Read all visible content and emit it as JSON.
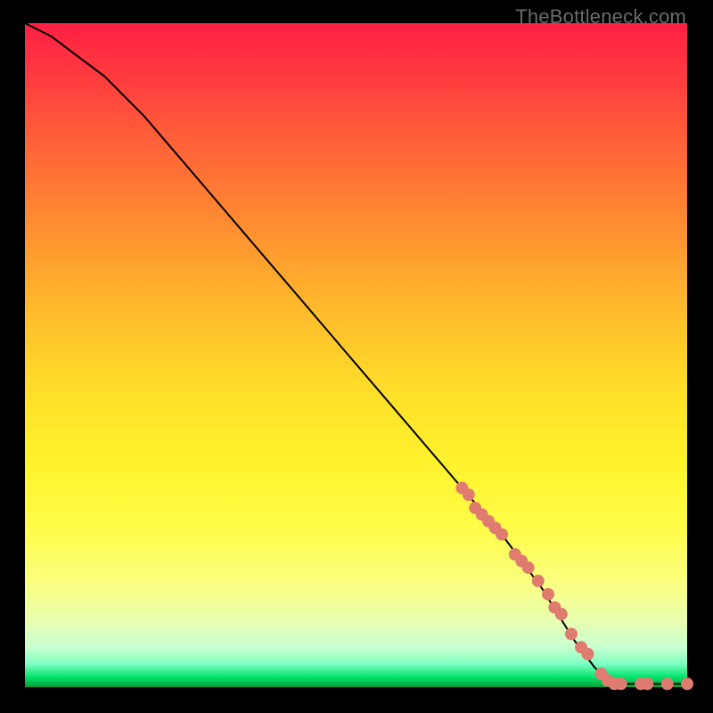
{
  "watermark": "TheBottleneck.com",
  "colors": {
    "dot": "#e07b6f",
    "curve": "#000000"
  },
  "chart_data": {
    "type": "line",
    "title": "",
    "xlabel": "",
    "ylabel": "",
    "xlim": [
      0,
      100
    ],
    "ylim": [
      0,
      100
    ],
    "series": [
      {
        "name": "curve",
        "x": [
          0,
          4,
          8,
          12,
          18,
          24,
          30,
          36,
          42,
          48,
          54,
          60,
          66,
          72,
          78,
          83,
          86,
          88,
          91,
          94,
          97,
          100
        ],
        "y": [
          100,
          98,
          95,
          92,
          86,
          79,
          72,
          65,
          58,
          51,
          44,
          37,
          30,
          23,
          15,
          7,
          3,
          1,
          0.5,
          0.5,
          0.5,
          0.5
        ]
      }
    ],
    "markers": [
      {
        "x": 66,
        "y": 30
      },
      {
        "x": 67,
        "y": 29
      },
      {
        "x": 68,
        "y": 27
      },
      {
        "x": 69,
        "y": 26
      },
      {
        "x": 70,
        "y": 25
      },
      {
        "x": 71,
        "y": 24
      },
      {
        "x": 72,
        "y": 23
      },
      {
        "x": 74,
        "y": 20
      },
      {
        "x": 75,
        "y": 19
      },
      {
        "x": 76,
        "y": 18
      },
      {
        "x": 77.5,
        "y": 16
      },
      {
        "x": 79,
        "y": 14
      },
      {
        "x": 80,
        "y": 12
      },
      {
        "x": 81,
        "y": 11
      },
      {
        "x": 82.5,
        "y": 8
      },
      {
        "x": 84,
        "y": 6
      },
      {
        "x": 85,
        "y": 5
      },
      {
        "x": 87,
        "y": 2
      },
      {
        "x": 88,
        "y": 1
      },
      {
        "x": 89,
        "y": 0.5
      },
      {
        "x": 90,
        "y": 0.5
      },
      {
        "x": 93,
        "y": 0.5
      },
      {
        "x": 94,
        "y": 0.5
      },
      {
        "x": 97,
        "y": 0.5
      },
      {
        "x": 100,
        "y": 0.5
      }
    ]
  }
}
